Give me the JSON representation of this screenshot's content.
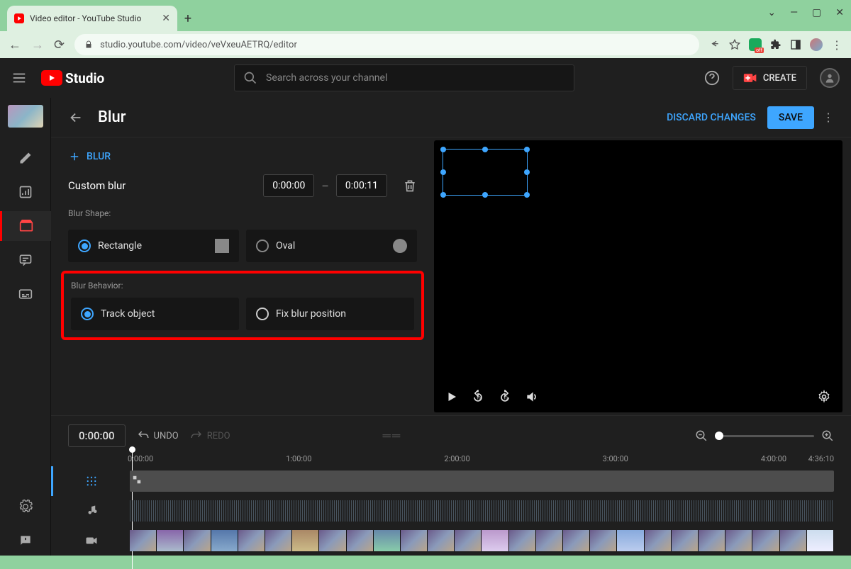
{
  "browser": {
    "tab_title": "Video editor - YouTube Studio",
    "url": "studio.youtube.com/video/veVxeuAETRQ/editor",
    "window_controls": {
      "min": "—",
      "max": "▢",
      "close": "✕",
      "dropdown": "⌄"
    }
  },
  "header": {
    "logo_text": "Studio",
    "search_placeholder": "Search across your channel",
    "create_label": "CREATE"
  },
  "page": {
    "title": "Blur",
    "discard": "DISCARD CHANGES",
    "save": "SAVE",
    "add_blur": "BLUR"
  },
  "blur_panel": {
    "name": "Custom blur",
    "time_start": "0:00:00",
    "time_end": "0:00:11",
    "shape_label": "Blur Shape:",
    "shape_rect": "Rectangle",
    "shape_oval": "Oval",
    "behavior_label": "Blur Behavior:",
    "behavior_track": "Track object",
    "behavior_fix": "Fix blur position"
  },
  "timeline": {
    "current": "0:00:00",
    "undo": "UNDO",
    "redo": "REDO",
    "ticks": [
      "0:00:00",
      "1:00:00",
      "2:00:00",
      "3:00:00",
      "4:00:00",
      "4:36:10"
    ]
  },
  "colors": {
    "accent": "#3ea6ff",
    "highlight": "#ff0000"
  }
}
